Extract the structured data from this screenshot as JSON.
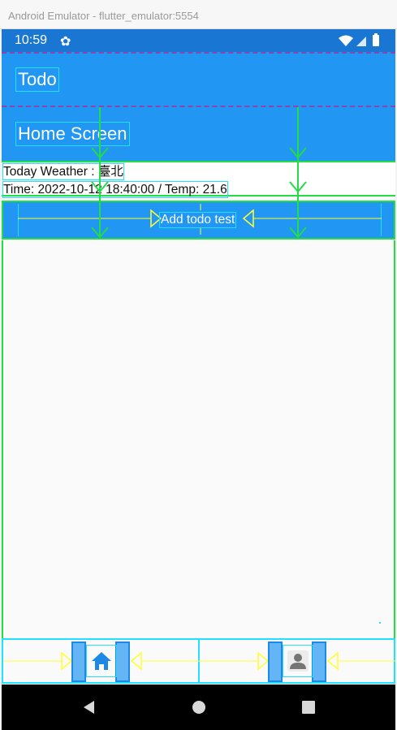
{
  "window": {
    "title": "Android Emulator - flutter_emulator:5554"
  },
  "statusbar": {
    "time": "10:59",
    "icons": [
      "gear-icon",
      "wifi-icon",
      "signal-icon",
      "battery-icon"
    ]
  },
  "appbar": {
    "title": "Todo"
  },
  "header": {
    "title": "Home Screen"
  },
  "weather": {
    "line1": "Today Weather : 臺北",
    "line2": "Time: 2022-10-12 18:40:00 / Temp: 21.6"
  },
  "actions": {
    "add_todo_label": "Add todo test"
  },
  "bottom_nav": {
    "items": [
      {
        "icon": "home-icon",
        "selected": true
      },
      {
        "icon": "person-icon",
        "selected": false
      }
    ]
  },
  "system_nav": {
    "buttons": [
      "back-icon",
      "home-circle-icon",
      "recents-icon"
    ]
  },
  "colors": {
    "primary": "#2196f3",
    "statusbar": "#1976d2",
    "debug_outline": "#22e0ff",
    "debug_green": "#22dd44",
    "debug_yellow": "#ffff33"
  }
}
